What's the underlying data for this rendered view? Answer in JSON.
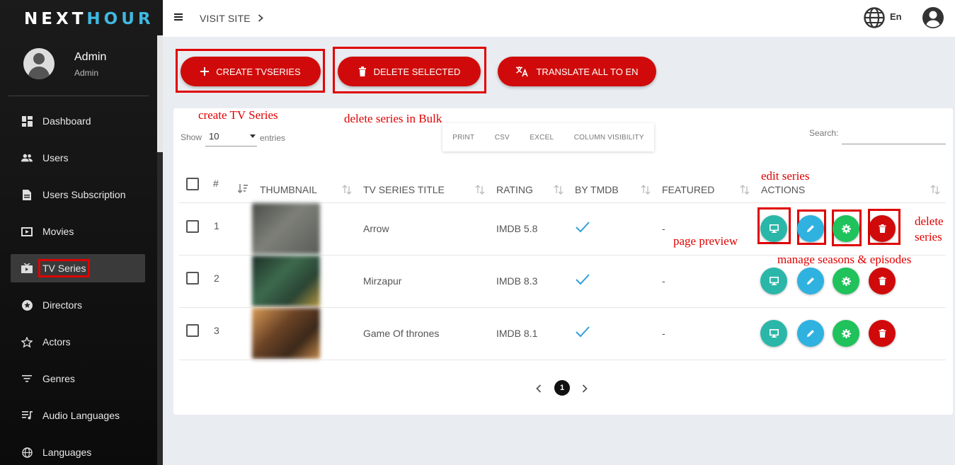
{
  "app": {
    "logo_a": "NEXT",
    "logo_b": "HOUR"
  },
  "user": {
    "name": "Admin",
    "role": "Admin"
  },
  "sidebar": {
    "items": [
      {
        "label": "Dashboard",
        "icon": "dashboard-icon"
      },
      {
        "label": "Users",
        "icon": "users-icon"
      },
      {
        "label": "Users Subscription",
        "icon": "document-icon"
      },
      {
        "label": "Movies",
        "icon": "movie-icon"
      },
      {
        "label": "TV Series",
        "icon": "tv-series-icon",
        "active": true
      },
      {
        "label": "Directors",
        "icon": "star-circle-icon"
      },
      {
        "label": "Actors",
        "icon": "star-outline-icon"
      },
      {
        "label": "Genres",
        "icon": "filter-lines-icon"
      },
      {
        "label": "Audio Languages",
        "icon": "playlist-icon"
      },
      {
        "label": "Languages",
        "icon": "globe-icon"
      }
    ]
  },
  "header": {
    "visit_site": "VISIT SITE",
    "language": "En"
  },
  "toolbar": {
    "create": "CREATE TVSERIES",
    "delete": "DELETE SELECTED",
    "translate": "TRANSLATE ALL TO EN"
  },
  "annotations": {
    "create": "create TV Series",
    "delete_bulk": "delete series in Bulk",
    "edit": "edit series",
    "preview": "page preview",
    "manage": "manage seasons & episodes",
    "delete_line1": "delete",
    "delete_line2": "series"
  },
  "table_controls": {
    "show": "Show",
    "page_size": "10",
    "entries": "entries",
    "export": [
      "PRINT",
      "CSV",
      "EXCEL",
      "COLUMN VISIBILITY"
    ],
    "search_label": "Search:"
  },
  "table": {
    "columns": [
      "#",
      "THUMBNAIL",
      "TV SERIES TITLE",
      "RATING",
      "BY TMDB",
      "FEATURED",
      "ACTIONS"
    ],
    "rows": [
      {
        "num": "1",
        "title": "Arrow",
        "rating": "IMDB 5.8",
        "by_tmdb": true,
        "featured": "-",
        "thumb_color": "#6a6e66"
      },
      {
        "num": "2",
        "title": "Mirzapur",
        "rating": "IMDB 8.3",
        "by_tmdb": true,
        "featured": "-",
        "thumb_color": "#2f4a3a"
      },
      {
        "num": "3",
        "title": "Game Of thrones",
        "rating": "IMDB 8.1",
        "by_tmdb": true,
        "featured": "-",
        "thumb_color": "#8a5a32"
      }
    ]
  },
  "pagination": {
    "current": "1",
    "prev": "‹",
    "next": "›"
  },
  "colors": {
    "primary_red": "#d00a0a",
    "preview": "#2ab7a9",
    "edit": "#2fb2e0",
    "manage": "#1fc25b",
    "tick": "#2fa0d8"
  }
}
